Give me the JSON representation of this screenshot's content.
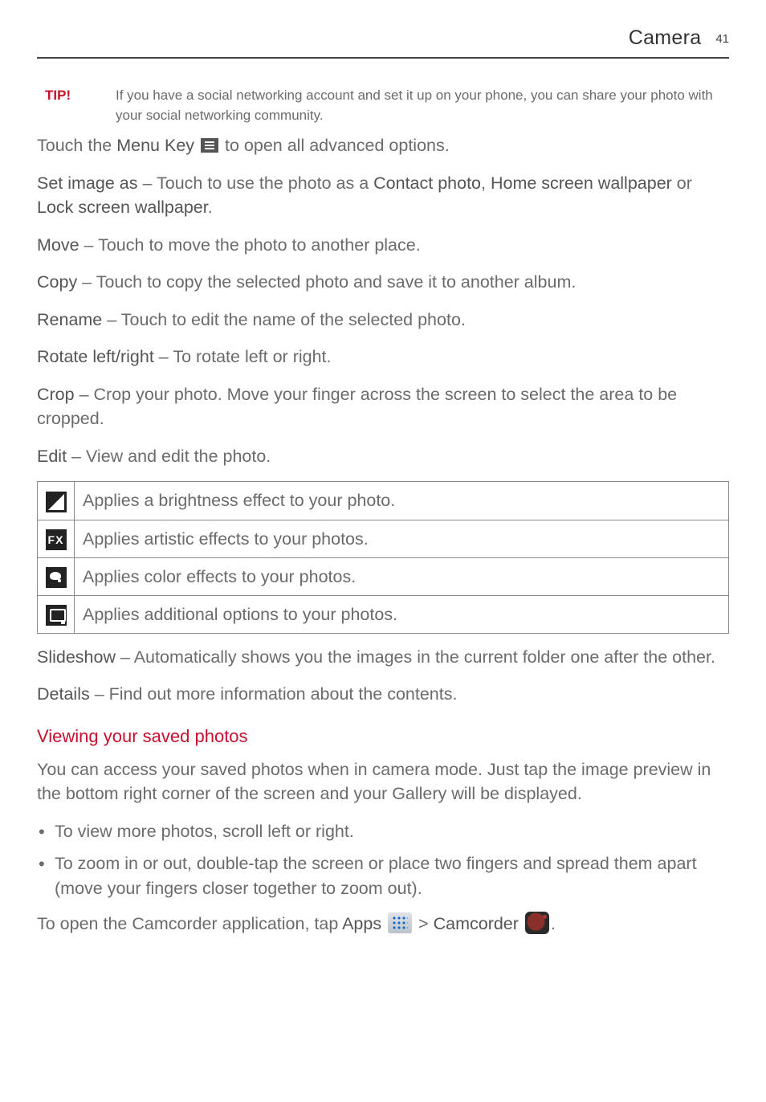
{
  "header": {
    "title": "Camera",
    "page_number": "41"
  },
  "tip": {
    "label": "TIP!",
    "text": "If you have a social networking account and set it up on your phone, you can share your photo with your social networking community."
  },
  "touch_menu": {
    "prefix": "Touch the ",
    "menu_key_label": "Menu Key",
    "suffix": " to open all advanced options."
  },
  "items": {
    "set_image_as": {
      "label": "Set image as",
      "text_a": " – Touch to use the photo as a ",
      "opt1": "Contact photo",
      "sep1": ", ",
      "opt2": "Home screen wallpaper",
      "sep2": " or ",
      "opt3": "Lock screen wallpaper",
      "end": "."
    },
    "move": {
      "label": "Move",
      "text": " – Touch to move the photo to another place."
    },
    "copy": {
      "label": "Copy",
      "text": " – Touch to copy the selected photo and save it to another album."
    },
    "rename": {
      "label": "Rename",
      "text": " – Touch to edit the name of the selected photo."
    },
    "rotate": {
      "label": "Rotate left/right",
      "text": " – To rotate left or right."
    },
    "crop": {
      "label": "Crop",
      "text": " – Crop your photo. Move your finger across the screen to select the area to be cropped."
    },
    "edit": {
      "label": "Edit",
      "text": " – View and edit the photo."
    },
    "slideshow": {
      "label": "Slideshow",
      "text": " – Automatically shows you the images in the current folder one after the other."
    },
    "details": {
      "label": "Details",
      "text": " – Find out more information about the contents."
    }
  },
  "edit_table": [
    {
      "icon": "brightness-icon",
      "desc": "Applies a brightness effect to your photo."
    },
    {
      "icon": "fx-icon",
      "desc": "Applies artistic effects to your photos."
    },
    {
      "icon": "color-effects-icon",
      "desc": "Applies color effects to your photos."
    },
    {
      "icon": "additional-options-icon",
      "desc": "Applies additional options to your photos."
    }
  ],
  "fx_glyph": "FX",
  "viewing": {
    "heading": "Viewing your saved photos",
    "intro": "You can access your saved photos when in camera mode. Just tap the image preview in the bottom right corner of the screen and your Gallery will be displayed.",
    "bullets": [
      "To view more photos, scroll left or right.",
      "To zoom in or out, double-tap the screen or place two fingers and spread them apart (move your fingers closer together to zoom out)."
    ]
  },
  "camcorder": {
    "prefix": "To open the Camcorder application, tap ",
    "apps_label": "Apps",
    "gt": " > ",
    "cam_label": "Camcorder",
    "end": "."
  }
}
